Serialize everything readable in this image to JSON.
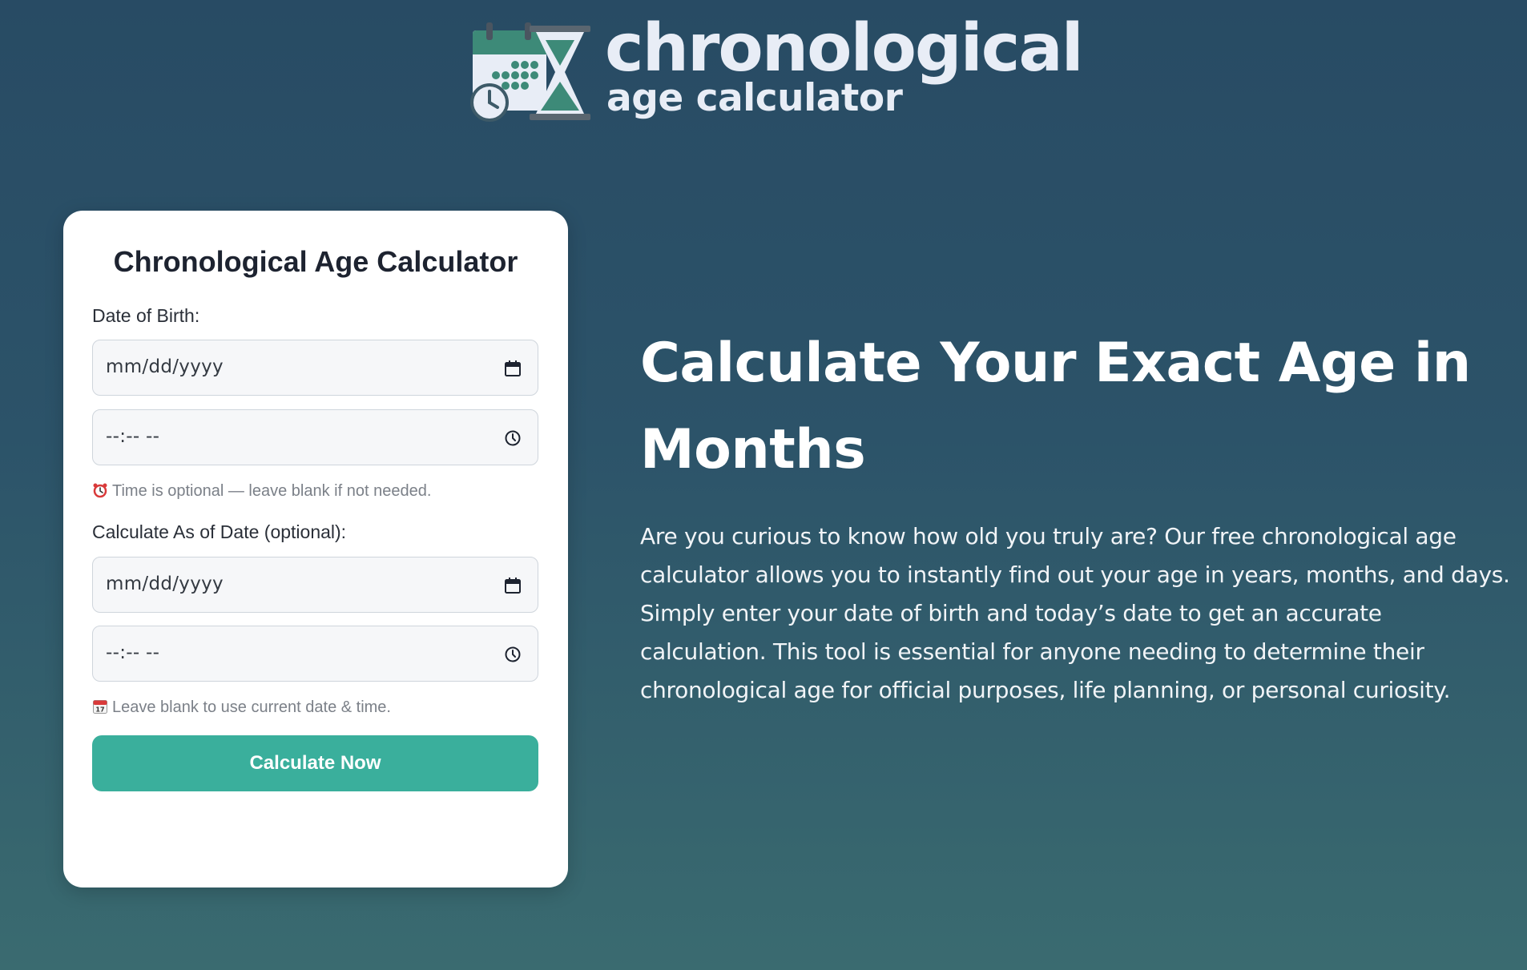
{
  "logo": {
    "title": "chronological",
    "subtitle": "age calculator",
    "icon": "calendar-hourglass-clock-icon"
  },
  "card": {
    "title": "Chronological Age Calculator",
    "dob_label": "Date of Birth:",
    "dob_date_placeholder": "mm/dd/yyyy",
    "dob_time_placeholder": "--:-- --",
    "time_hint": "Time is optional — leave blank if not needed.",
    "asof_label": "Calculate As of Date (optional):",
    "asof_date_placeholder": "mm/dd/yyyy",
    "asof_time_placeholder": "--:-- --",
    "asof_hint": "Leave blank to use current date & time.",
    "button_label": "Calculate Now"
  },
  "hero": {
    "title": "Calculate Your Exact Age in Months",
    "text": "Are you curious to know how old you truly are? Our free chronological age calculator allows you to instantly find out your age in years, months, and days. Simply enter your date of birth and today’s date to get an accurate calculation. This tool is essential for anyone needing to determine their chronological age for official purposes, life planning, or personal curiosity."
  },
  "colors": {
    "background_top": "#284b64",
    "background_bottom": "#3a6b70",
    "accent": "#3aaf9c",
    "logo_teal": "#3d8a78"
  }
}
